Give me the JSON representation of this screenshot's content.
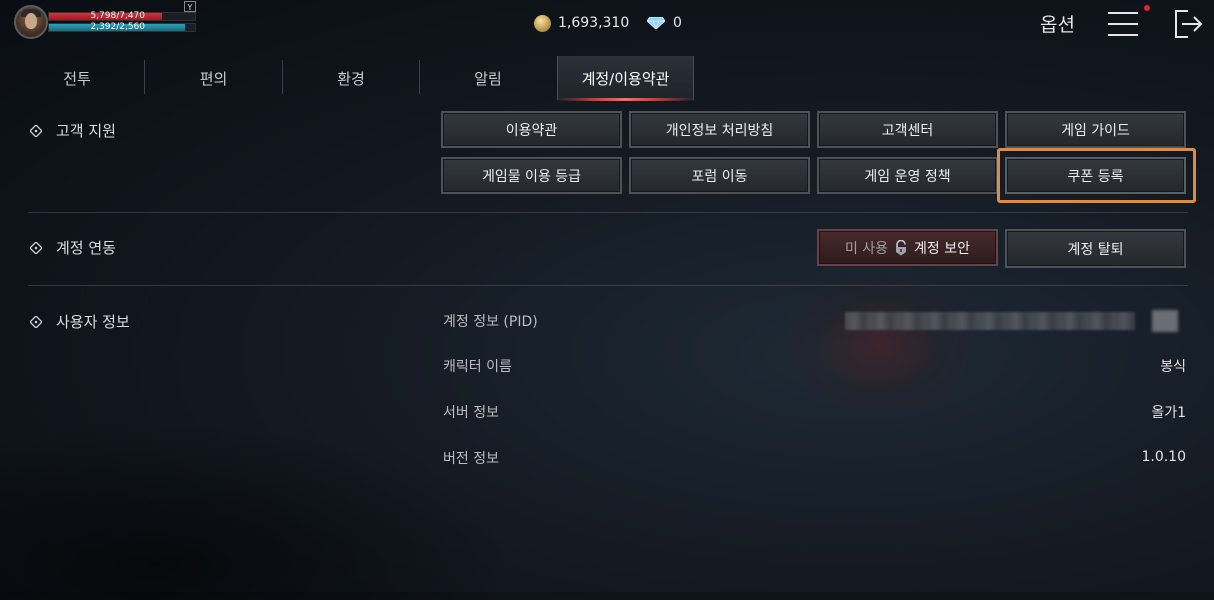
{
  "player": {
    "hp_text": "5,798/7,470",
    "hp_fraction": 0.776,
    "mp_text": "2,392/2,560",
    "mp_fraction": 0.934,
    "hotkey": "Y"
  },
  "currencies": {
    "gold": "1,693,310",
    "diamond": "0"
  },
  "header": {
    "options_label": "옵션",
    "menu_icon": "hamburger-menu-icon",
    "exit_icon": "exit-icon"
  },
  "tabs": [
    {
      "label": "전투",
      "active": false
    },
    {
      "label": "편의",
      "active": false
    },
    {
      "label": "환경",
      "active": false
    },
    {
      "label": "알림",
      "active": false
    },
    {
      "label": "계정/이용약관",
      "active": true
    }
  ],
  "customer_support": {
    "title": "고객 지원",
    "buttons": [
      "이용약관",
      "개인정보 처리방침",
      "고객센터",
      "게임 가이드",
      "게임물 이용 등급",
      "포럼 이동",
      "게임 운영 정책",
      "쿠폰 등록"
    ]
  },
  "account_link": {
    "title": "계정 연동",
    "security_state": "미 사용",
    "security_label": "계정 보안",
    "withdraw_label": "계정 탈퇴"
  },
  "user_info": {
    "title": "사용자 정보",
    "rows": [
      {
        "label": "계정 정보 (PID)",
        "value": ""
      },
      {
        "label": "캐릭터 이름",
        "value": "봉식"
      },
      {
        "label": "서버 정보",
        "value": "올가1"
      },
      {
        "label": "버전 정보",
        "value": "1.0.10"
      }
    ]
  },
  "colors": {
    "highlight": "#e8893a",
    "hp": "#d8333d",
    "mp": "#2aa3b8",
    "accent_red": "#e03a3a"
  }
}
